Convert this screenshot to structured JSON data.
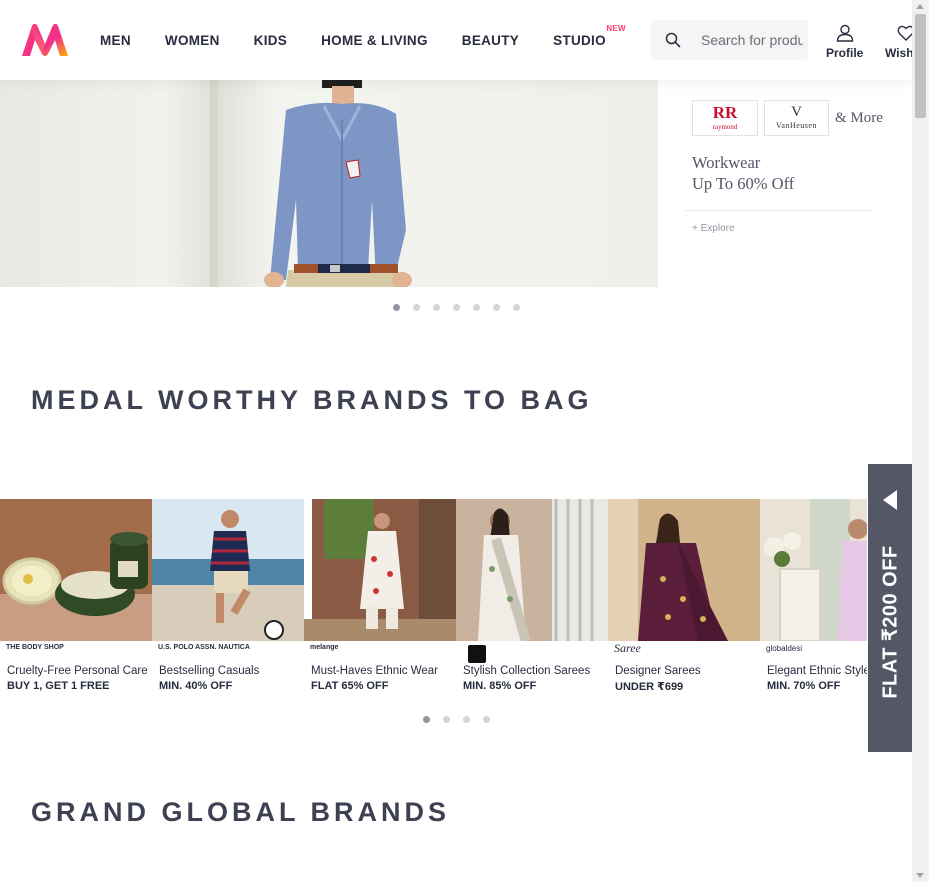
{
  "header": {
    "nav": [
      "MEN",
      "WOMEN",
      "KIDS",
      "HOME & LIVING",
      "BEAUTY",
      "STUDIO"
    ],
    "studio_badge": "NEW",
    "search_placeholder": "Search for products, brands and more",
    "profile_label": "Profile",
    "wishlist_label": "Wishlist"
  },
  "hero": {
    "brand1_name": "RR",
    "brand1_sub": "raymond",
    "brand2_name": "V",
    "brand2_sub": "VanHeusen",
    "and_more": "& More",
    "title_line1": "Workwear",
    "title_line2": "Up To 60% Off",
    "explore": "+ Explore",
    "slide_count": 7,
    "active_slide": 1
  },
  "sections": {
    "medal": "MEDAL WORTHY BRANDS TO BAG",
    "global": "GRAND GLOBAL BRANDS"
  },
  "brand_cards": [
    {
      "logo": "THE BODY SHOP",
      "desc": "Cruelty-Free Personal Care",
      "offer": "BUY 1, GET 1 FREE"
    },
    {
      "logo": "U.S. POLO ASSN.   NAUTICA",
      "desc": "Bestselling Casuals",
      "offer": "MIN. 40% OFF"
    },
    {
      "logo": "melange",
      "desc": "Must-Haves Ethnic Wear",
      "offer": "FLAT 65% OFF"
    },
    {
      "logo": "",
      "desc": "Stylish Collection Sarees",
      "offer": "MIN. 85% OFF"
    },
    {
      "logo": "Saree",
      "desc": "Designer Sarees",
      "offer": "UNDER ₹699"
    },
    {
      "logo": "globaldesi",
      "desc": "Elegant Ethnic Styles",
      "offer": "MIN. 70% OFF"
    }
  ],
  "brand_slider": {
    "slide_count": 4,
    "active_slide": 1
  },
  "offer_tab": "FLAT ₹200 OFF",
  "colors": {
    "accent": "#ff3f6c",
    "tab_bg": "#535766",
    "title": "#3e4152"
  }
}
